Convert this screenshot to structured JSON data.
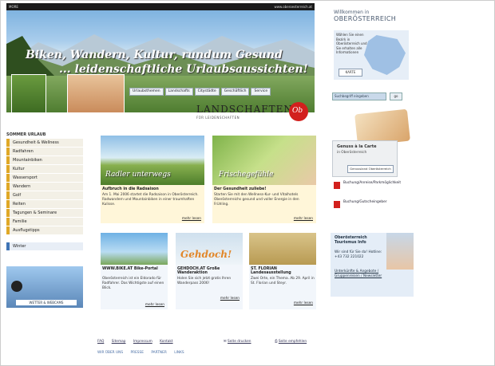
{
  "topbar": {
    "left": "MORE",
    "right": "www.oberoesterreich.at"
  },
  "hero": {
    "slogan_line1": "Biken, Wandern, Kultur, rundum Gesund",
    "slogan_line2": "... leidenschaftliche Urlaubsaussichten!"
  },
  "topnav": [
    "Urlaubsthemen",
    "Landschafts",
    "Citystädte",
    "Geschäftlich",
    "Service"
  ],
  "brand": {
    "title": "LANDSCHAFTEN",
    "subtitle": "FÜR LEIDENSCHAFTEN",
    "seal": "Ob"
  },
  "right_head": {
    "welcome": "Willkommen in",
    "region": "OBERÖSTERREICH"
  },
  "map": {
    "text": "Wählen Sie einen Bezirk in Oberösterreich und Sie erhalten alle Informationen",
    "button": "KARTE"
  },
  "search": {
    "placeholder": "Suchbegriff eingeben",
    "button": "go"
  },
  "leftnav": {
    "heading": "SOMMER URLAUB",
    "items": [
      "Gesundheit & Wellness",
      "Radfahren",
      "Mountainbiken",
      "Kultur",
      "Wassersport",
      "Wandern",
      "Golf",
      "Reiten",
      "Tagungen & Seminare",
      "Familie",
      "Ausflugstipps"
    ],
    "winter": "Winter"
  },
  "leftbox": {
    "label": "WETTER & WEBCAMS"
  },
  "cards": {
    "radler": {
      "caption": "Radler unterwegs",
      "title": "Aufbruch in die Radsaison",
      "body": "Am 1. Mai 2006 startet die Radsaison in Oberösterreich. Radwandern und Mountainbiken in einer traumhaften Kulisse.",
      "more": "mehr lesen"
    },
    "frische": {
      "caption": "Frischegefühle",
      "title": "Der Gesundheit zuliebe!",
      "body": "Starten Sie mit den Wellness-Kur- und Vitalhotels Oberösterreichs gesund und voller Energie in den Frühling.",
      "more": "mehr lesen"
    },
    "bike": {
      "title": "WWW.BIKE.AT Bike-Portal",
      "body": "Oberösterreich ist ein Eldorado für Radfahrer. Das Wichtigste auf einen Blick.",
      "more": "mehr lesen"
    },
    "wandern": {
      "caption": "Gehdoch!",
      "title": "GEHDOCH.AT Große Wanderaktion",
      "body": "Holen Sie sich jetzt gratis Ihren Wanderpass 2006!",
      "more": "mehr lesen"
    },
    "florian": {
      "title": "ST. FLORIAN Landesausstellung",
      "body": "Zwei Orte, ein Thema. Ab 29. April in St. Florian und Steyr.",
      "more": "mehr lesen"
    }
  },
  "side": {
    "food_title": "Genuss à la Carte",
    "food_sub": "in Oberösterreich",
    "food_btn": "Genussland Oberösterreich",
    "link1": "Buchung/Anreise/Parkmöglichkeit",
    "link2": "Buchung/Gutscheingeber",
    "tourism_title": "Oberösterreich Tourismus Info",
    "tourism_body": "Wir sind für Sie da! Hotline: +43 732 221022",
    "tourism_links": "Unterkünfte & Angebote / Gruppenreisen / Newsletter"
  },
  "footer": {
    "links1": [
      "FAQ",
      "Sitemap",
      "Impressum",
      "Kontakt"
    ],
    "print": "Seite drucken",
    "recommend": "Seite empfehlen",
    "links2": [
      "WIR ÜBER UNS",
      "PRESSE",
      "PARTNER",
      "LINKS"
    ]
  }
}
